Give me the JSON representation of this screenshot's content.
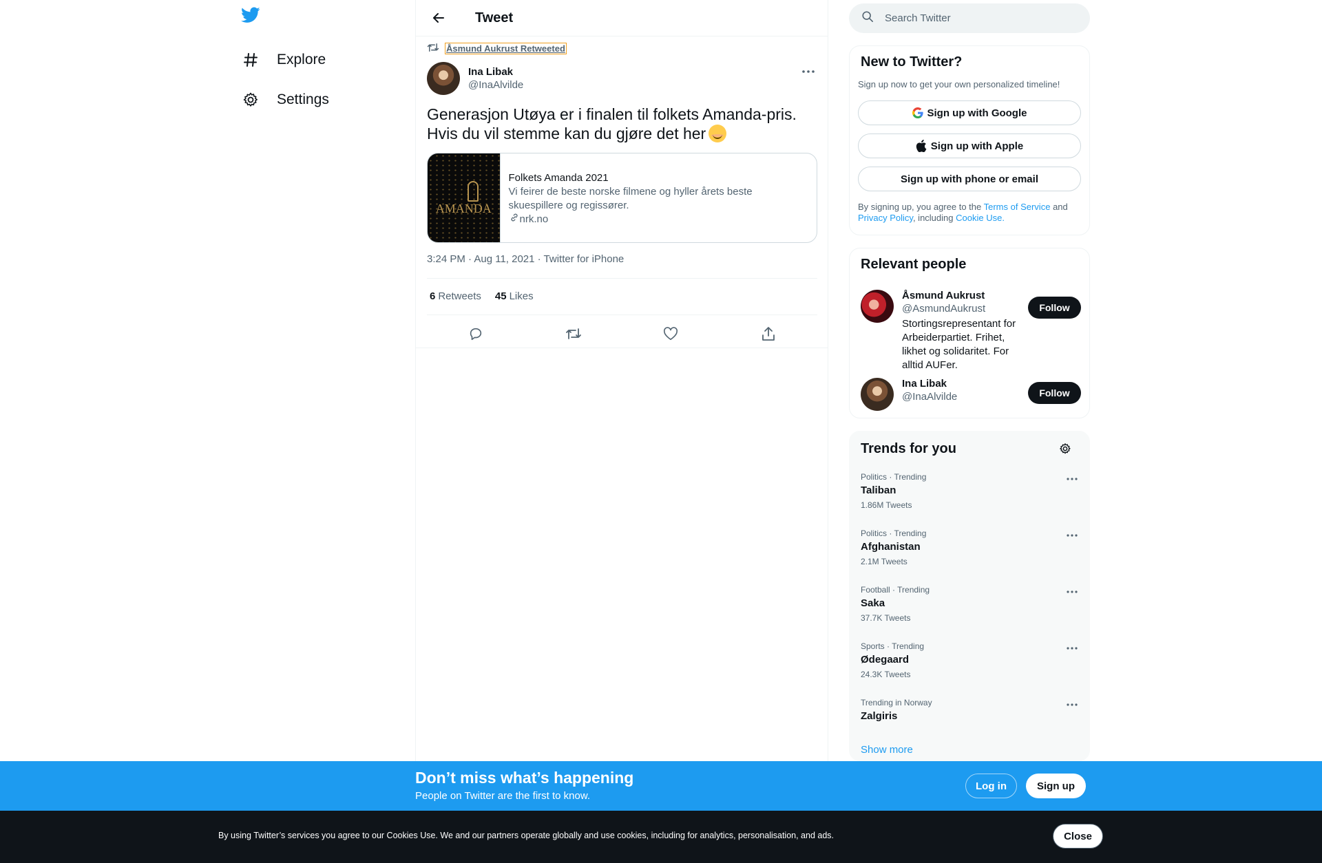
{
  "nav": {
    "items": [
      {
        "label": "Explore",
        "icon": "hashtag-icon"
      },
      {
        "label": "Settings",
        "icon": "gear-icon"
      }
    ]
  },
  "header": {
    "title": "Tweet"
  },
  "tweet": {
    "retweeted_by": "Åsmund Aukrust Retweeted",
    "author_name": "Ina Libak",
    "author_handle": "@InaAlvilde",
    "text": "Generasjon Utøya er i finalen til folkets Amanda-pris. Hvis du vil stemme kan du gjøre det her",
    "card": {
      "image_text": "AMANDA",
      "title": "Folkets Amanda 2021",
      "description": "Vi feirer de beste norske filmene og hyller årets beste skuespillere og regissører.",
      "domain": "nrk.no"
    },
    "meta": "3:24 PM · Aug 11, 2021 · Twitter for iPhone",
    "retweets_count": "6",
    "retweets_label": "Retweets",
    "likes_count": "45",
    "likes_label": "Likes"
  },
  "search": {
    "placeholder": "Search Twitter"
  },
  "signup": {
    "title": "New to Twitter?",
    "subtitle": "Sign up now to get your own personalized timeline!",
    "google": "Sign up with Google",
    "apple": "Sign up with Apple",
    "phone_email": "Sign up with phone or email",
    "legal_prefix": "By signing up, you agree to the",
    "terms": "Terms of Service",
    "and": "and",
    "privacy": "Privacy Policy",
    "including": ", including",
    "cookie": "Cookie Use."
  },
  "relevant_people": {
    "title": "Relevant people",
    "people": [
      {
        "name": "Åsmund Aukrust",
        "handle": "@AsmundAukrust",
        "bio": "Stortingsrepresentant for Arbeiderpartiet. Frihet, likhet og solidaritet. For alltid AUFer.",
        "follow": "Follow"
      },
      {
        "name": "Ina Libak",
        "handle": "@InaAlvilde",
        "bio": "",
        "follow": "Follow"
      }
    ]
  },
  "trends": {
    "title": "Trends for you",
    "items": [
      {
        "context": "Politics · Trending",
        "name": "Taliban",
        "count": "1.86M Tweets"
      },
      {
        "context": "Politics · Trending",
        "name": "Afghanistan",
        "count": "2.1M Tweets"
      },
      {
        "context": "Football · Trending",
        "name": "Saka",
        "count": "37.7K Tweets"
      },
      {
        "context": "Sports · Trending",
        "name": "Ødegaard",
        "count": "24.3K Tweets"
      },
      {
        "context": "Trending in Norway",
        "name": "Zalgiris",
        "count": ""
      }
    ],
    "show_more": "Show more"
  },
  "bottom_bar": {
    "title": "Don’t miss what’s happening",
    "subtitle": "People on Twitter are the first to know.",
    "login": "Log in",
    "signup": "Sign up"
  },
  "cookie_bar": {
    "text": "By using Twitter’s services you agree to our Cookies Use. We and our partners operate globally and use cookies, including for analytics, personalisation, and ads.",
    "close": "Close"
  },
  "colors": {
    "brand_blue": "#1d9bf0",
    "text_primary": "#0f1419",
    "text_secondary": "#536471"
  }
}
